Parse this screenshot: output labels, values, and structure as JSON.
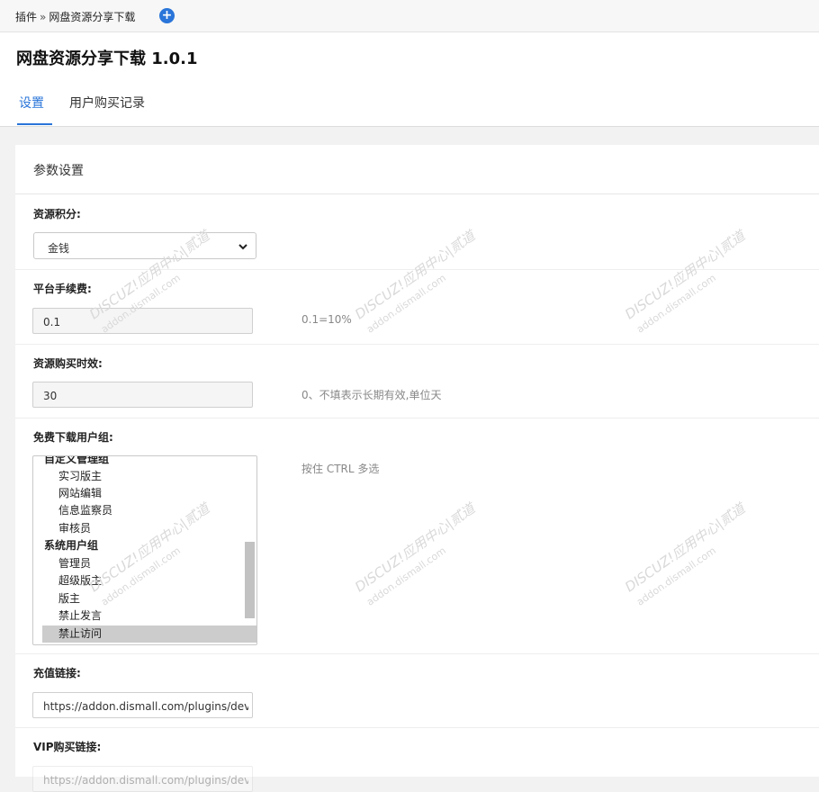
{
  "breadcrumb": {
    "root": "插件",
    "separator": "»",
    "current": "网盘资源分享下载"
  },
  "header": {
    "title": "网盘资源分享下载 1.0.1",
    "tabs": [
      {
        "label": "设置",
        "active": true
      },
      {
        "label": "用户购买记录",
        "active": false
      }
    ]
  },
  "panel": {
    "title": "参数设置",
    "fields": {
      "resource_points": {
        "label": "资源积分:",
        "value": "金钱"
      },
      "platform_fee": {
        "label": "平台手续费:",
        "value": "0.1",
        "hint": "0.1=10%"
      },
      "purchase_validity": {
        "label": "资源购买时效:",
        "value": "30",
        "hint": "0、不填表示长期有效,单位天"
      },
      "free_groups": {
        "label": "免费下载用户组:",
        "hint": "按住 CTRL 多选",
        "options": [
          {
            "text": "自定义管理组",
            "type": "group"
          },
          {
            "text": "实习版主",
            "type": "item"
          },
          {
            "text": "网站编辑",
            "type": "item"
          },
          {
            "text": "信息监察员",
            "type": "item"
          },
          {
            "text": "审核员",
            "type": "item"
          },
          {
            "text": "系统用户组",
            "type": "group"
          },
          {
            "text": "管理员",
            "type": "item"
          },
          {
            "text": "超级版主",
            "type": "item"
          },
          {
            "text": "版主",
            "type": "item"
          },
          {
            "text": "禁止发言",
            "type": "item"
          },
          {
            "text": "禁止访问",
            "type": "item",
            "selected": true
          }
        ]
      },
      "recharge_link": {
        "label": "充值链接:",
        "value": "https://addon.dismall.com/plugins/dev"
      },
      "vip_link": {
        "label": "VIP购买链接:",
        "value": "https://addon.dismall.com/plugins/dev"
      }
    }
  },
  "watermark": {
    "brand": "DISCUZ!应用中心|贰道",
    "url": "addon.dismall.com"
  },
  "colors": {
    "accent": "#2a75d9"
  }
}
